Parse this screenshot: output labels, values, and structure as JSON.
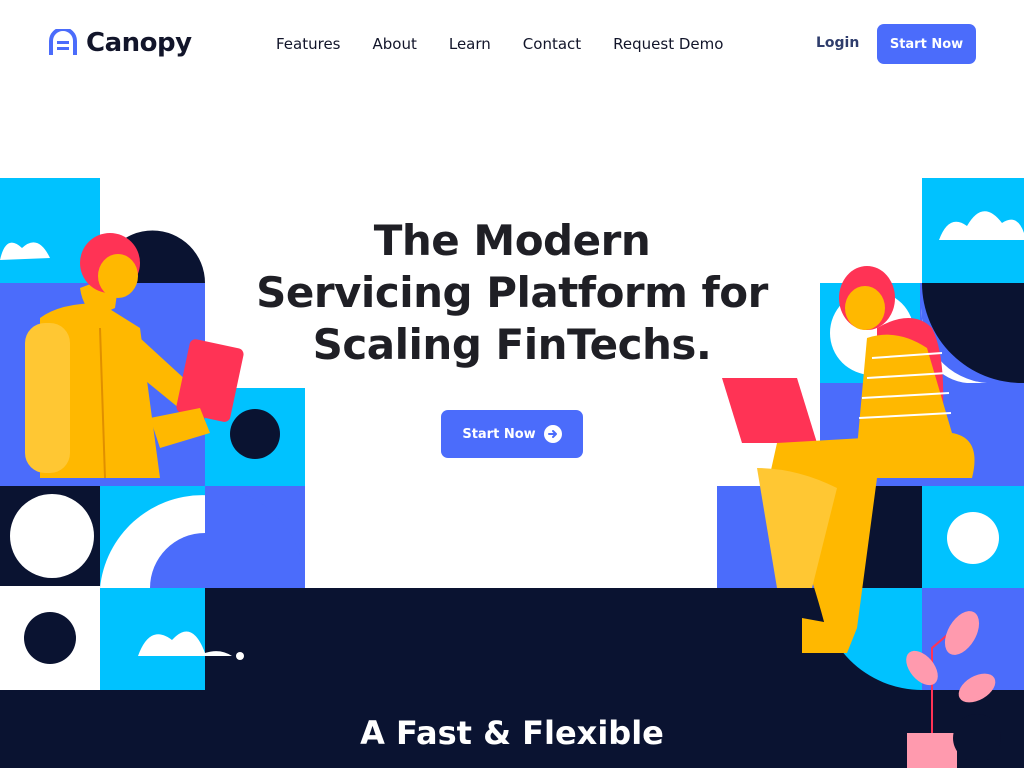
{
  "brand": {
    "name": "Canopy",
    "color": "#4b6cfb"
  },
  "nav": {
    "items": [
      "Features",
      "About",
      "Learn",
      "Contact",
      "Request Demo"
    ],
    "login_label": "Login",
    "cta_label": "Start Now"
  },
  "hero": {
    "title_lines": [
      "The Modern",
      "Servicing Platform for",
      "Scaling FinTechs."
    ],
    "cta_label": "Start Now",
    "cta_icon": "arrow-right-circle-icon"
  },
  "section": {
    "title": "A Fast & Flexible"
  },
  "colors": {
    "primary": "#4b6cfb",
    "cyan": "#00c2ff",
    "navy": "#0a1331",
    "yellow": "#ffb800",
    "red": "#ff3355"
  }
}
